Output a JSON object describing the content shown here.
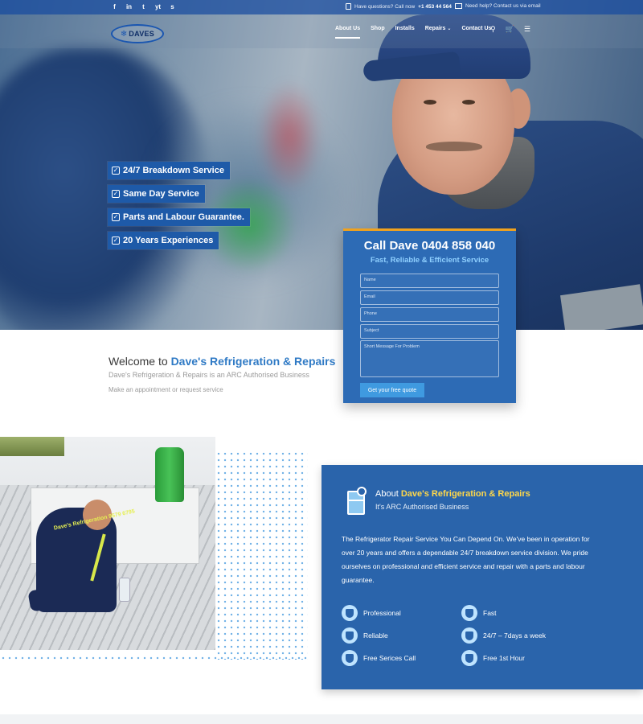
{
  "topbar": {
    "social": [
      "f",
      "in",
      "t",
      "yt",
      "s"
    ],
    "call_label": "Have questions? Call now",
    "phone": "+1 453 44 564",
    "email_label": "Need help? Contact us via email"
  },
  "logo": {
    "text": "DAVES",
    "icon": "snowflake-icon"
  },
  "nav": {
    "items": [
      {
        "label": "About Us",
        "active": true
      },
      {
        "label": "Shop"
      },
      {
        "label": "Installs"
      },
      {
        "label": "Repairs",
        "dropdown": true
      },
      {
        "label": "Contact Us"
      }
    ],
    "icons": [
      "search-icon",
      "cart-icon",
      "menu-icon"
    ]
  },
  "badges": [
    "24/7 Breakdown Service",
    "Same Day Service",
    "Parts and Labour Guarantee.",
    "20 Years Experiences"
  ],
  "form": {
    "title": "Call Dave 0404 858 040",
    "subtitle": "Fast, Reliable & Efficient Service",
    "placeholders": {
      "name": "Name",
      "email": "Email",
      "phone": "Phone",
      "subject": "Subject",
      "message": "Short Message For Problem"
    },
    "submit": "Get your free quote"
  },
  "welcome": {
    "prefix": "Welcome to",
    "brand": "Dave's Refrigeration & Repairs",
    "line2": "Dave's Refrigeration & Repairs is an ARC Authorised Business",
    "line3": "Make an appointment or request service"
  },
  "photo": {
    "shirt_text": "Dave's Refrigeration 9579 6795"
  },
  "about": {
    "prefix": "About",
    "brand": "Dave's Refrigeration & Repairs",
    "subtitle": "It's ARC Authorised Business",
    "paragraph": "The Refrigerator Repair Service You Can Depend On. We've been in operation for over 20 years and offers a dependable 24/7 breakdown service division. We pride ourselves on professional and efficient service and repair with a parts and labour guarantee.",
    "features": [
      "Professional",
      "Fast",
      "Reliable",
      "24/7 – 7days a week",
      "Free Serices Call",
      "Free 1st Hour"
    ]
  },
  "colors": {
    "primary": "#2a64ab",
    "accent": "#2f7ac5",
    "highlight": "#ffd84a",
    "button": "#3f9ae0"
  }
}
